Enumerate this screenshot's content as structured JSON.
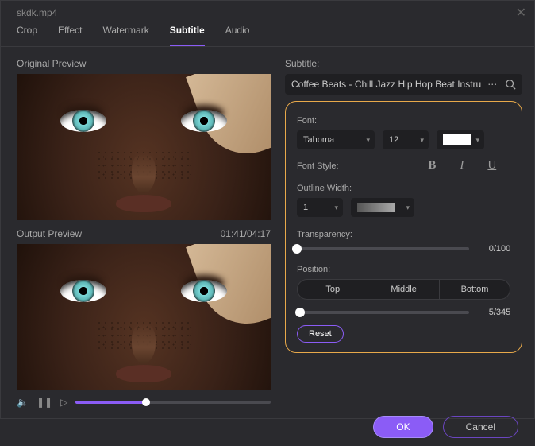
{
  "titlebar": {
    "filename": "skdk.mp4"
  },
  "tabs": {
    "items": [
      "Crop",
      "Effect",
      "Watermark",
      "Subtitle",
      "Audio"
    ],
    "active_index": 3
  },
  "left": {
    "original_label": "Original Preview",
    "output_label": "Output Preview",
    "time": "01:41/04:17"
  },
  "playback": {
    "progress_pct": 36
  },
  "right": {
    "subtitle_label": "Subtitle:",
    "subtitle_file": "Coffee Beats - Chill Jazz Hip Hop Beat Instru",
    "font_label": "Font:",
    "font_name": "Tahoma",
    "font_size": "12",
    "font_style_label": "Font Style:",
    "outline_label": "Outline Width:",
    "outline_value": "1",
    "transparency_label": "Transparency:",
    "transparency_value": "0/100",
    "transparency_pct": 0,
    "position_label": "Position:",
    "pos_top": "Top",
    "pos_middle": "Middle",
    "pos_bottom": "Bottom",
    "pos_value": "5/345",
    "pos_pct": 2,
    "reset_label": "Reset"
  },
  "footer": {
    "ok": "OK",
    "cancel": "Cancel"
  }
}
